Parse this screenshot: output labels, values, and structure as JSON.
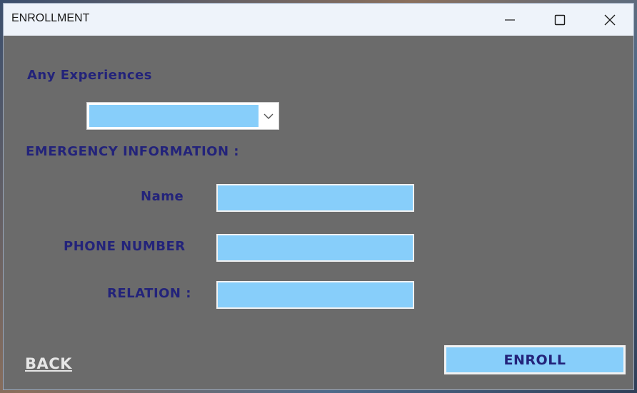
{
  "window": {
    "title": "ENROLLMENT",
    "controls": [
      "minimize-icon",
      "maximize-icon",
      "close-icon"
    ]
  },
  "form": {
    "experience_label": "Any Experiences",
    "experience_value": "",
    "emergency_heading": "EMERGENCY INFORMATION :",
    "name_label": "Name",
    "name_value": "",
    "phone_label": "PHONE NUMBER",
    "phone_value": "",
    "relation_label": "RELATION :",
    "relation_value": ""
  },
  "actions": {
    "back_label": "BACK",
    "enroll_label": "ENROLL"
  },
  "colors": {
    "panel": "#6b6b6b",
    "field": "#87cefa",
    "label": "#23237a",
    "back_link": "#e6e6e6"
  }
}
